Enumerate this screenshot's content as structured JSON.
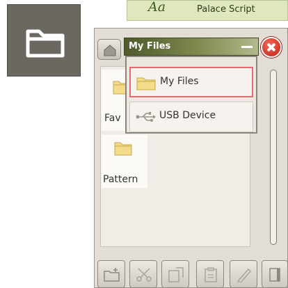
{
  "font_bar": {
    "sample": "Aa",
    "font_name": "Palace Script"
  },
  "window": {
    "title": "My Files"
  },
  "location_menu": {
    "items": [
      {
        "label": "My Files",
        "selected": true
      },
      {
        "label": "USB Device",
        "selected": false
      }
    ]
  },
  "files": [
    {
      "label": "Fav"
    },
    {
      "label": "Pattern"
    }
  ],
  "icons": {
    "tile": "folder-icon",
    "home": "home-icon",
    "close": "close-icon",
    "minimize": "minimize-icon",
    "usb": "usb-icon",
    "toolbar": [
      "new-folder-icon",
      "cut-icon",
      "copy-icon",
      "paste-icon",
      "rename-icon",
      "details-icon"
    ]
  },
  "colors": {
    "accent_green": "#4e5a2a",
    "selection_border": "#e26b6b",
    "close_red": "#c21f14",
    "tile_bg": "#6b6860"
  }
}
